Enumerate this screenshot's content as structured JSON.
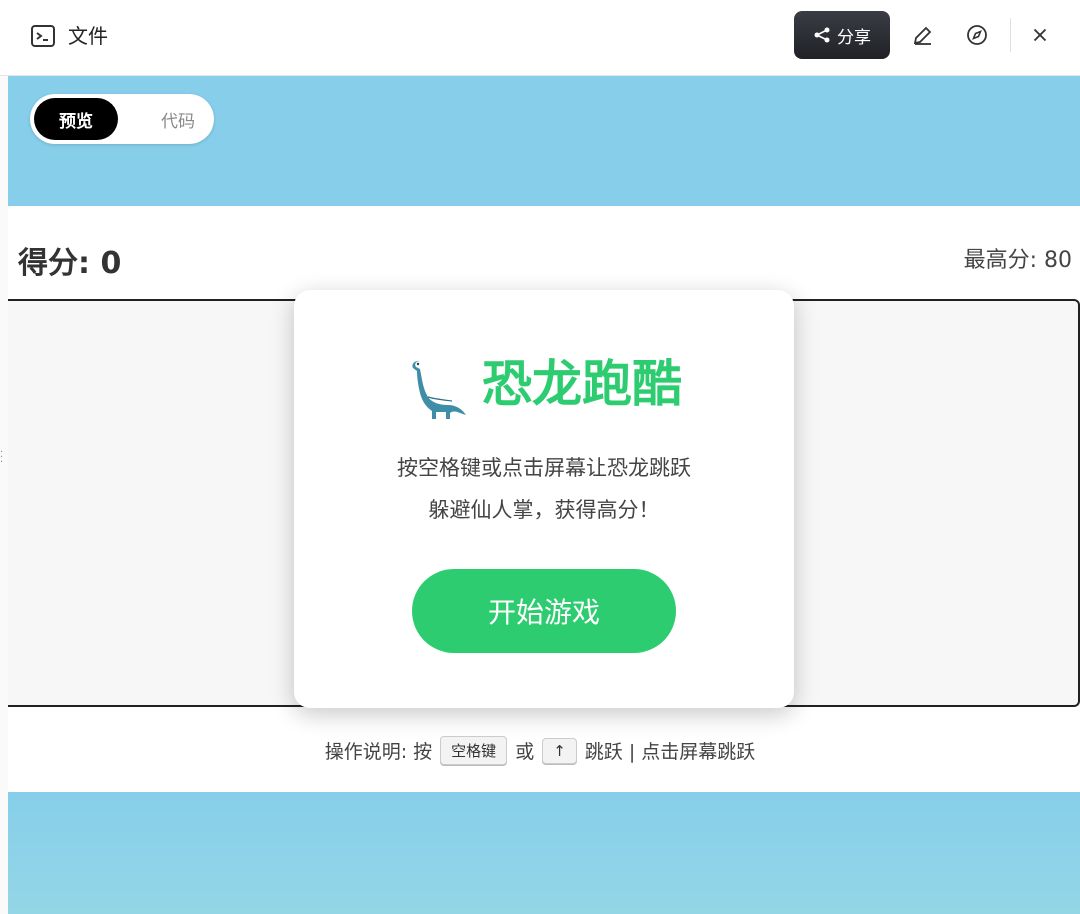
{
  "header": {
    "file_icon": "terminal-file-icon",
    "title": "文件",
    "share_label": "分享",
    "share_icon": "share-icon",
    "edit_icon": "pencil-icon",
    "compass_icon": "compass-icon",
    "close_icon": "close-icon"
  },
  "view_toggle": {
    "preview_label": "预览",
    "code_label": "代码",
    "active": "预览"
  },
  "game": {
    "score_label": "得分: 0",
    "high_score_label": "最高分: 80",
    "modal": {
      "title": "恐龙跑酷",
      "title_icon": "dinosaur-icon",
      "line1": "按空格键或点击屏幕让恐龙跳跃",
      "line2": "躲避仙人掌，获得高分！",
      "start_button": "开始游戏"
    },
    "instructions": {
      "prefix": "操作说明: 按",
      "key1": "空格键",
      "or": "或",
      "key2": "↑",
      "suffix": "跳跃 | 点击屏幕跳跃"
    }
  },
  "colors": {
    "sky": "#87ceea",
    "accent_green": "#2ecc71",
    "share_button": "#2b2d33"
  }
}
